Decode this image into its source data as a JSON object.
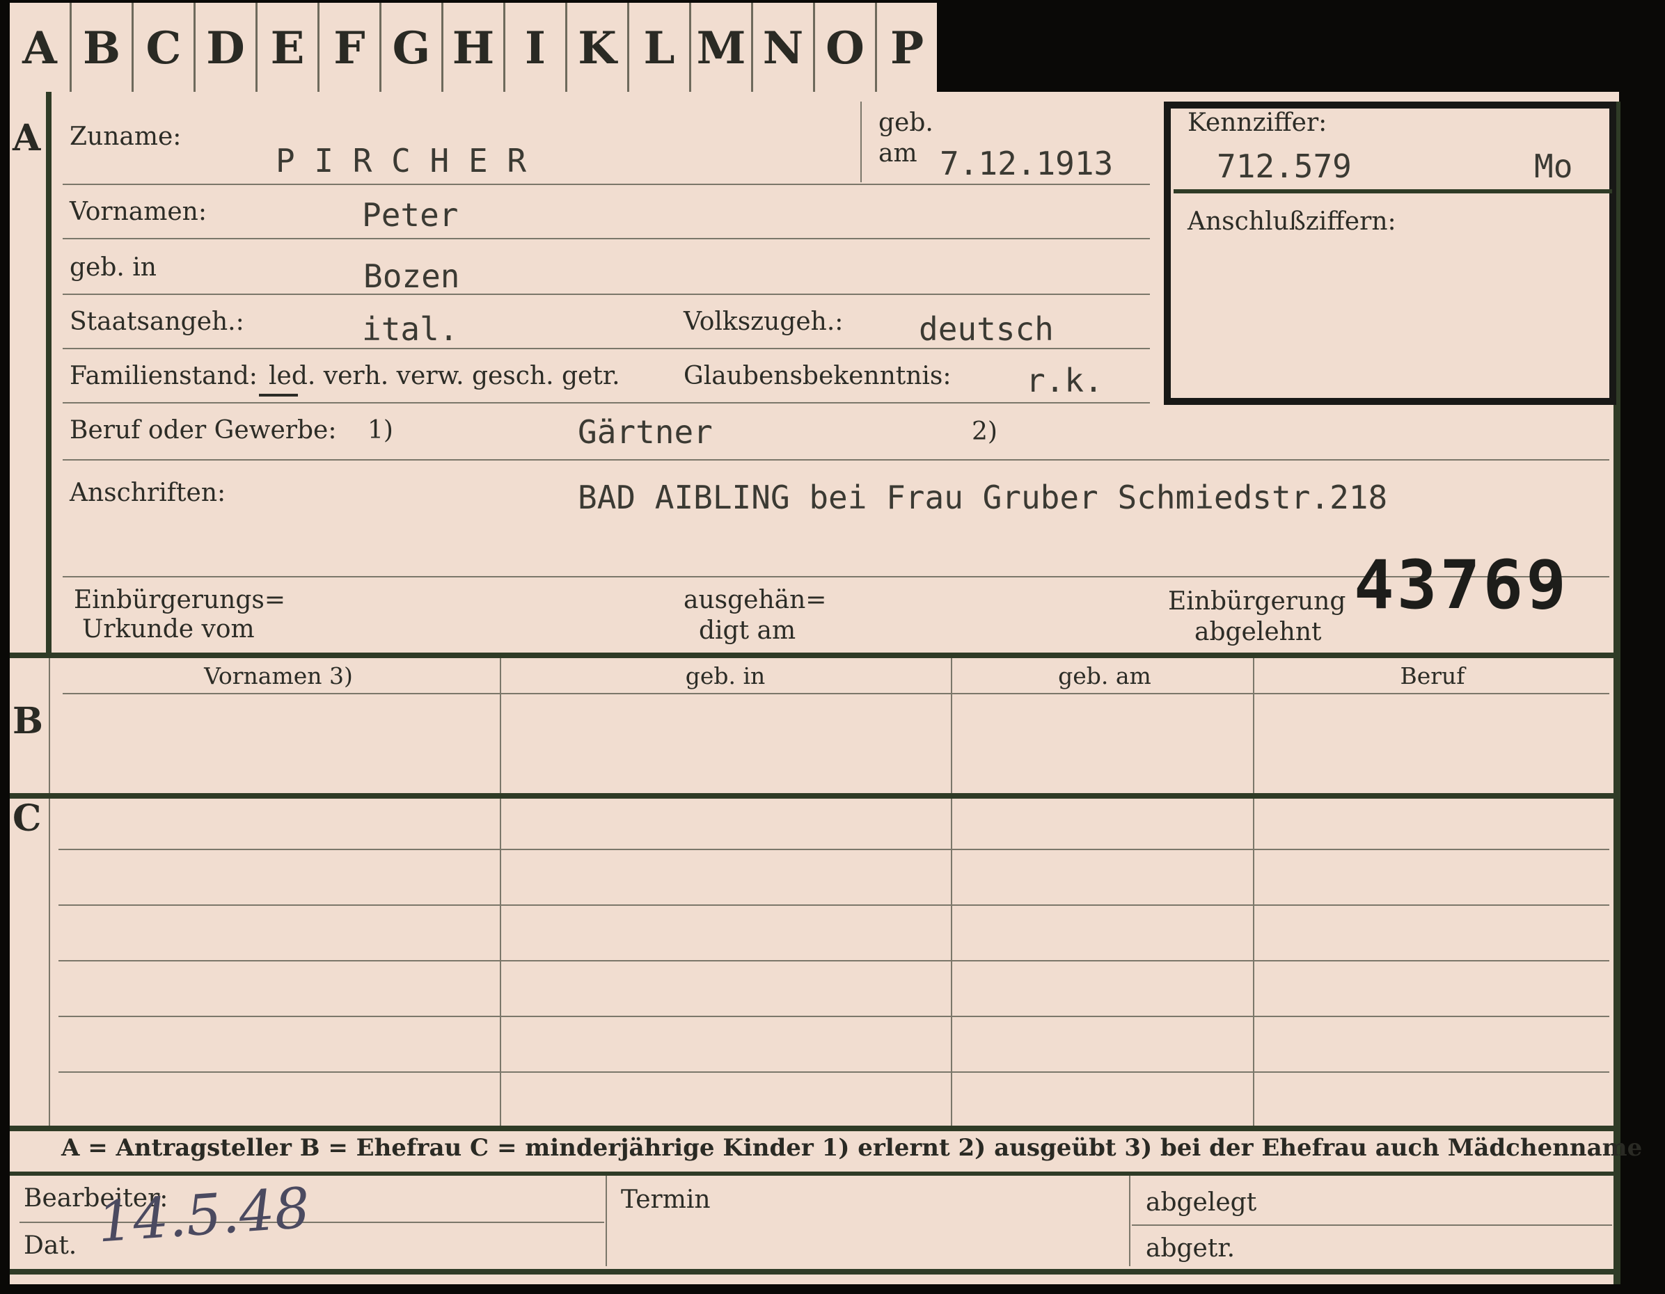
{
  "tabs": [
    "A",
    "B",
    "C",
    "D",
    "E",
    "F",
    "G",
    "H",
    "I",
    "K",
    "L",
    "M",
    "N",
    "O",
    "P"
  ],
  "sections": {
    "a": "A",
    "b": "B",
    "c": "C"
  },
  "labels": {
    "zuname": "Zuname:",
    "geb_am_1": "geb.",
    "geb_am_2": "am",
    "kennziffer": "Kennziffer:",
    "anschluss": "Anschlußziffern:",
    "vornamen": "Vornamen:",
    "geb_in": "geb. in",
    "staatsangeh": "Staatsangeh.:",
    "volkszugeh": "Volkszugeh.:",
    "familienstand": "Familienstand:",
    "familienstand_options": "led. verh. verw. gesch. getr.",
    "glauben": "Glaubensbekenntnis:",
    "beruf": "Beruf oder Gewerbe:",
    "beruf_fn1": "1)",
    "beruf_fn2": "2)",
    "anschriften": "Anschriften:",
    "urkunde_1": "Einbürgerungs=",
    "urkunde_2": "Urkunde vom",
    "ausgehaendigt_1": "ausgehän=",
    "ausgehaendigt_2": "digt am",
    "abgelehnt_1": "Einbürgerung",
    "abgelehnt_2": "abgelehnt",
    "bearbeiter": "Bearbeiter:",
    "dat": "Dat.",
    "termin": "Termin",
    "abgelegt": "abgelegt",
    "abgetr": "abgetr."
  },
  "values": {
    "zuname": "P I R C H E R",
    "geb_am": "7.12.1913",
    "kennziffer": "712.579",
    "kennziffer_suffix": "Mo",
    "vornamen": "Peter",
    "geb_in": "Bozen",
    "staatsangeh": "ital.",
    "volkszugeh": "deutsch",
    "glauben": "r.k.",
    "beruf": "Gärtner",
    "anschriften": "BAD AIBLING bei Frau Gruber Schmiedstr.218",
    "stamp_number": "43769",
    "datum": "14.5.48"
  },
  "table_headers": [
    "Vornamen 3)",
    "geb. in",
    "geb. am",
    "Beruf"
  ],
  "legend": "A = Antragsteller   B = Ehefrau   C = minderjährige Kinder   1) erlernt   2) ausgeübt   3) bei der Ehefrau auch Mädchenname"
}
